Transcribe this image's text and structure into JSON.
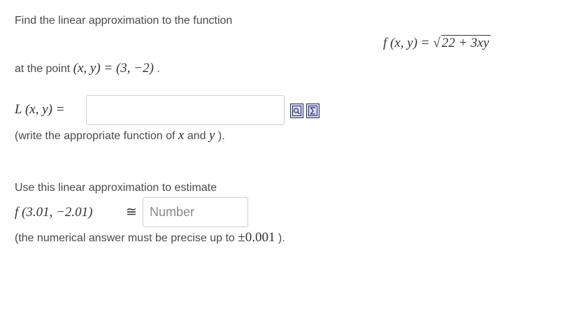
{
  "intro_text": "Find the linear approximation to the function",
  "function": {
    "lhs": "f (x, y) =",
    "radicand": "22 + 3xy"
  },
  "point_text": {
    "prefix": "at the point",
    "math": "(x, y) = (3, −2)",
    "suffix": "."
  },
  "linear": {
    "label": "L (x, y) =",
    "input_value": "",
    "note_prefix": "(write the appropriate function of",
    "note_x": "x",
    "note_and": "and",
    "note_y": "y",
    "note_suffix": ")."
  },
  "icons": [
    "formula-preview-icon",
    "sigma-equation-editor-icon"
  ],
  "estimate": {
    "intro": "Use this linear approximation to estimate",
    "expr": "f (3.01, −2.01)",
    "approx_symbol": "≅",
    "placeholder": "Number",
    "precision_prefix": "(the numerical answer must be precise up to",
    "precision_value": "±0.001",
    "precision_suffix": ")."
  },
  "colors": {
    "icon_fill": "#d8dcf4",
    "icon_border": "#2b2b5a",
    "input_border": "#cfcfcf"
  }
}
